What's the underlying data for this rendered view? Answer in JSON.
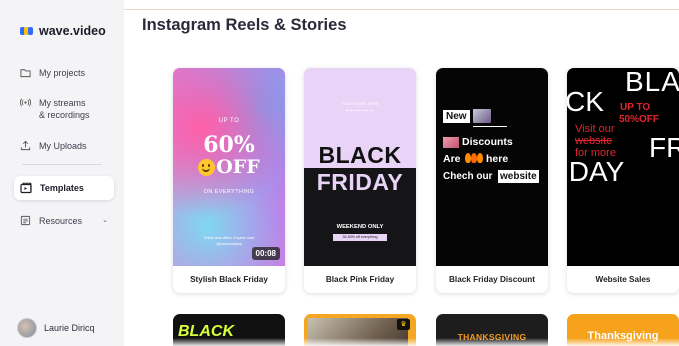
{
  "app": {
    "name": "wave.video"
  },
  "sidebar": {
    "items": [
      {
        "label": "My projects"
      },
      {
        "label": "My streams\n& recordings"
      },
      {
        "label": "My Uploads"
      },
      {
        "label": "Templates"
      },
      {
        "label": "Resources"
      }
    ],
    "user": {
      "name": "Laurie Diricq"
    }
  },
  "main": {
    "title": "Instagram Reels & Stories",
    "cards": [
      {
        "title": "Stylish Black Friday",
        "duration": "00:08",
        "texts": {
          "up_to": "UP TO",
          "percent": "60%",
          "off": "OFF",
          "on_everything": "ON EVERYTHING",
          "small1": "Online and offline. Explore now!",
          "small2": "@yourcompany"
        }
      },
      {
        "title": "Black Pink Friday",
        "texts": {
          "top": "YOUR STORY HERE",
          "black": "BLACK",
          "friday": "FRIDAY",
          "weekend": "WEEKEND ONLY",
          "discount": "35-50% off everything"
        }
      },
      {
        "title": "Black Friday Discount",
        "texts": {
          "new": "New",
          "discounts": "Discounts",
          "are": "Are",
          "here": "here",
          "chech": "Chech our",
          "website": "website"
        }
      },
      {
        "title": "Website Sales",
        "texts": {
          "bla": "BLA",
          "ck": "CK",
          "up_to": "UP TO",
          "off": "50%OFF",
          "visit1": "Visit our",
          "visit2": "website",
          "visit3": "for more",
          "fr": "FR",
          "iday": "IDAY"
        }
      }
    ],
    "row2": [
      {
        "text": "BLACK"
      },
      {
        "text": ""
      },
      {
        "text": "THANKSGIVING"
      },
      {
        "text": "Thanksgiving"
      }
    ]
  },
  "colors": {
    "sidebar_bg": "#f4f4f6",
    "logo_blue": "#2f6bff",
    "logo_yellow": "#ffc400",
    "pink_card": "#e9d3f6",
    "website_red": "#e0262f"
  }
}
